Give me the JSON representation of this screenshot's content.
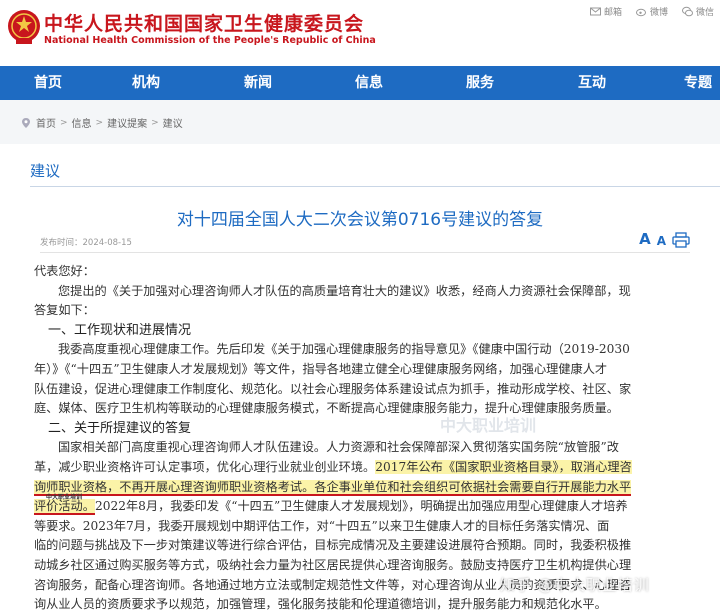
{
  "header": {
    "site_name_cn": "中华人民共和国国家卫生健康委员会",
    "site_name_en": "National Health Commission of the People's Republic of China",
    "top_links": [
      {
        "label": "邮箱",
        "icon": "mail-icon"
      },
      {
        "label": "微博",
        "icon": "weibo-icon"
      },
      {
        "label": "微信",
        "icon": "wechat-icon"
      }
    ]
  },
  "nav": {
    "items": [
      "首页",
      "机构",
      "新闻",
      "信息",
      "服务",
      "互动",
      "专题"
    ]
  },
  "breadcrumb": {
    "items": [
      "首页",
      "信息",
      "建议提案",
      "建议"
    ]
  },
  "section": {
    "title": "建议"
  },
  "article": {
    "title": "对十四届全国人大二次会议第0716号建议的答复",
    "date_label": "发布时间：2024-08-15",
    "font_large": "A",
    "font_small": "A",
    "lines": [
      "代表您好：",
      "您提出的《关于加强对心理咨询师人才队伍的高质量培育壮大的建议》收悉，经商人力资源社会保障部，现",
      "答复如下：",
      "一、工作现状和进展情况",
      "我委高度重视心理健康工作。先后印发《关于加强心理健康服务的指导意见》《健康中国行动（2019-2030",
      "年）》《“十四五”卫生健康人才发展规划》等文件，指导各地建立健全心理健康服务网络，加强心理健康人才",
      "队伍建设，促进心理健康工作制度化、规范化。以社会心理服务体系建设试点为抓手，推动形成学校、社区、家",
      "庭、媒体、医疗卫生机构等联动的心理健康服务模式，不断提高心理健康服务能力，提升心理健康服务质量。",
      "二、关于所提建议的答复",
      "国家相关部门高度重视心理咨询师人才队伍建设。人力资源和社会保障部深入贯彻落实国务院“放管服”改",
      "革，减少职业资格许可认定事项，优化心理行业就业创业环境。"
    ],
    "hl_line_a": "2017年公布《国家职业资格目录》，取消心理咨",
    "hl_line_b1": "询师职业资格，不再开展心理咨询师职业资格考试。",
    "hl_line_b2": "各企事业单位和社会组织可依据社会需要自行开展能力水平",
    "hl_line_c": "评价活动。",
    "after_hl_c": "2022年8月，我委印发《“十四五”卫生健康人才发展规划》，明确提出加强应用型心理健康人才培养",
    "lines2": [
      "等要求。2023年7月，我委开展规划中期评估工作，对“十四五”以来卫生健康人才的目标任务落实情况、面",
      "临的问题与挑战及下一步对策建议等进行综合评估，目标完成情况及主要建设进展符合预期。同时，我委积极推",
      "动城乡社区通过购买服务等方式，吸纳社会力量为社区居民提供心理咨询服务。鼓励支持医疗卫生机构提供心理",
      "咨询服务，配备心理咨询师。各地通过地方立法或制定规范性文件等，对心理咨询从业人员的资质要求、心理咨",
      "询从业人员的资质要求予以规范，加强管理，强化服务技能和伦理道德培训，提升服务能力和规范化水平。"
    ]
  },
  "overlay": {
    "stamp_text": "中大职业培训",
    "watermark_mid": "中大职业培训",
    "watermark_bottom": "知乎 @中大职业培训"
  }
}
